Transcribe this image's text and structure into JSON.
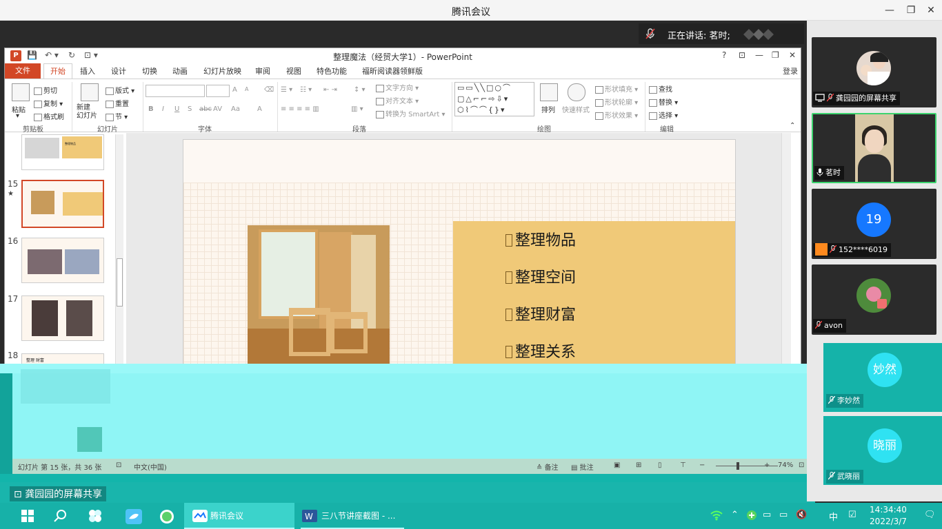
{
  "meeting": {
    "title": "腾讯会议",
    "speaking_label": "正在讲话: 茗时;",
    "share_label": "龚园园的屏幕共享"
  },
  "powerpoint": {
    "title": "整理魔法（经贸大学1）- PowerPoint",
    "help": "?",
    "login": "登录",
    "tabs": [
      "文件",
      "开始",
      "插入",
      "设计",
      "切换",
      "动画",
      "幻灯片放映",
      "审阅",
      "视图",
      "特色功能",
      "福昕阅读器领鲜版"
    ],
    "active_tab": "开始",
    "ribbon": {
      "clipboard": {
        "label": "剪贴板",
        "paste": "粘贴",
        "cut": "剪切",
        "copy": "复制",
        "format_painter": "格式刷"
      },
      "slides": {
        "label": "幻灯片",
        "new_slide": "新建\n幻灯片",
        "layout": "版式",
        "reset": "重置",
        "section": "节"
      },
      "font": {
        "label": "字体",
        "bold": "B",
        "italic": "I",
        "underline": "U",
        "shadow": "S",
        "strike": "abc",
        "spacing": "AV",
        "case": "Aa",
        "color": "A",
        "grow": "A",
        "shrink": "A"
      },
      "paragraph": {
        "label": "段落",
        "text_direction": "文字方向",
        "align_text": "对齐文本",
        "smartart": "转换为 SmartArt"
      },
      "drawing": {
        "label": "绘图",
        "arrange": "排列",
        "quick_styles": "快速样式",
        "fill": "形状填充",
        "outline": "形状轮廓",
        "effects": "形状效果"
      },
      "editing": {
        "label": "编辑",
        "find": "查找",
        "replace": "替换",
        "select": "选择"
      }
    },
    "slide_numbers": [
      "15",
      "16",
      "17",
      "18"
    ],
    "slide_star": "★",
    "slide_thumb_text": {
      "s14": "整理物品",
      "s18": "整理 财富"
    },
    "current_slide": {
      "bullets": [
        "整理物品",
        "整理空间",
        "整理财富",
        "整理关系"
      ]
    },
    "status": {
      "slide_info": "幻灯片 第 15 张，共 36 张",
      "language": "中文(中国)",
      "notes": "备注",
      "comments": "批注",
      "zoom": "74%"
    }
  },
  "participants": [
    {
      "name": "龚园园的屏幕共享",
      "type": "photo"
    },
    {
      "name": "茗时",
      "type": "video",
      "active": true
    },
    {
      "name": "152****6019",
      "avatar_text": "19",
      "type": "number"
    },
    {
      "name": "avon",
      "type": "photo"
    },
    {
      "name": "李妙然",
      "avatar_text": "妙然",
      "type": "cyan"
    },
    {
      "name": "武晓丽",
      "avatar_text": "晓丽",
      "type": "cyan"
    }
  ],
  "taskbar": {
    "apps": [
      {
        "label": "腾讯会议",
        "active": true
      },
      {
        "label": "三八节讲座截图 - ...",
        "active": false
      }
    ],
    "ime": "中",
    "time": "14:34:40",
    "date": "2022/3/7"
  },
  "colors": {
    "ppt_accent": "#d24726",
    "gold_panel": "#f0c978",
    "active_speaker": "#3cd46e",
    "avatar_blue": "#1678ff",
    "taskbar": "#17b1a8"
  }
}
